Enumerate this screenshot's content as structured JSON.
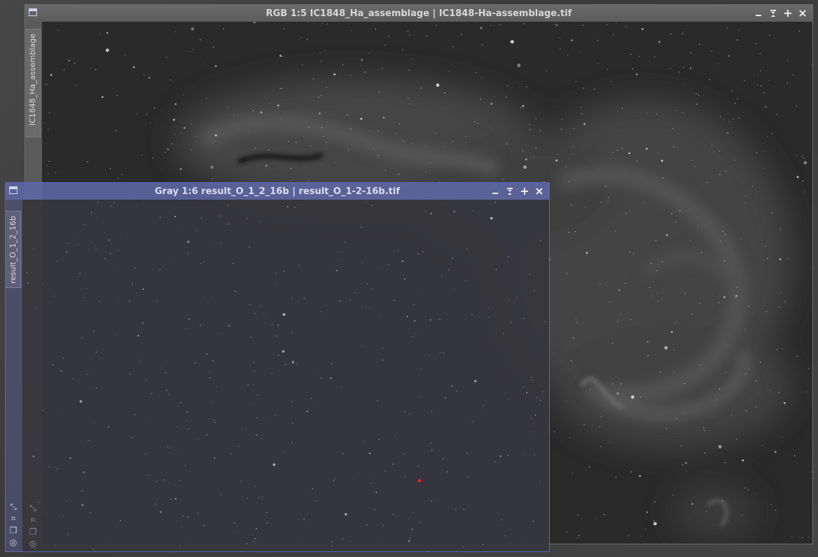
{
  "windows": {
    "main": {
      "title": "RGB 1:5 IC1848_Ha_assemblage | IC1848-Ha-assemblage.tif",
      "side_tab": "IC1848_Ha_assemblage"
    },
    "overlay": {
      "title": "Gray 1:6 result_O_1_2_16b | result_O_1-2-16b.tif",
      "side_tab": "result_O_1_2_16b"
    }
  },
  "controls": {
    "minimize": "–",
    "shade": "⧖",
    "maximize": "+",
    "close": "×"
  },
  "tool_icons": [
    "fit-view-icon",
    "zoom-fit-icon",
    "clone-icon",
    "target-icon"
  ],
  "colors": {
    "overlay_border": "#5b63b8",
    "cursor_marker": "#ff2020"
  }
}
